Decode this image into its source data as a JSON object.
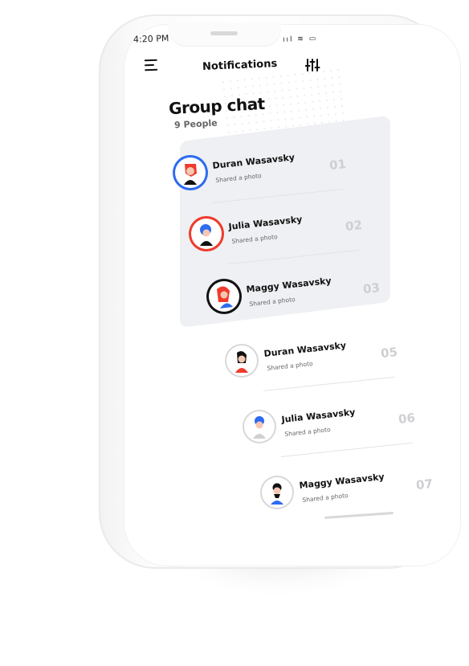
{
  "status_bar": {
    "time": "4:20 PM",
    "indicators": "ııl ≋ ▭"
  },
  "header": {
    "title": "Notifications",
    "menu_icon": "hamburger-menu-icon",
    "filter_icon": "sliders-icon"
  },
  "group": {
    "title": "Group chat",
    "people": "9 People"
  },
  "notifications": [
    {
      "name": "Duran Wasavsky",
      "subtitle": "Shared a photo",
      "number": "01",
      "ring_color": "#2d6bf0",
      "highlighted": true
    },
    {
      "name": "Julia Wasavsky",
      "subtitle": "Shared a photo",
      "number": "02",
      "ring_color": "#ef3b2d",
      "highlighted": true
    },
    {
      "name": "Maggy Wasavsky",
      "subtitle": "Shared a photo",
      "number": "03",
      "ring_color": "#111111",
      "highlighted": true
    },
    {
      "name": "Duran Wasavsky",
      "subtitle": "Shared a photo",
      "number": "05",
      "ring_color": "#d8d8d8",
      "highlighted": false
    },
    {
      "name": "Julia Wasavsky",
      "subtitle": "Shared a photo",
      "number": "06",
      "ring_color": "#d8d8d8",
      "highlighted": false
    },
    {
      "name": "Maggy Wasavsky",
      "subtitle": "Shared a photo",
      "number": "07",
      "ring_color": "#d8d8d8",
      "highlighted": false
    }
  ],
  "colors": {
    "accent_blue": "#2d6bf0",
    "accent_red": "#ef3b2d",
    "highlight_bg": "#eef0f3"
  }
}
